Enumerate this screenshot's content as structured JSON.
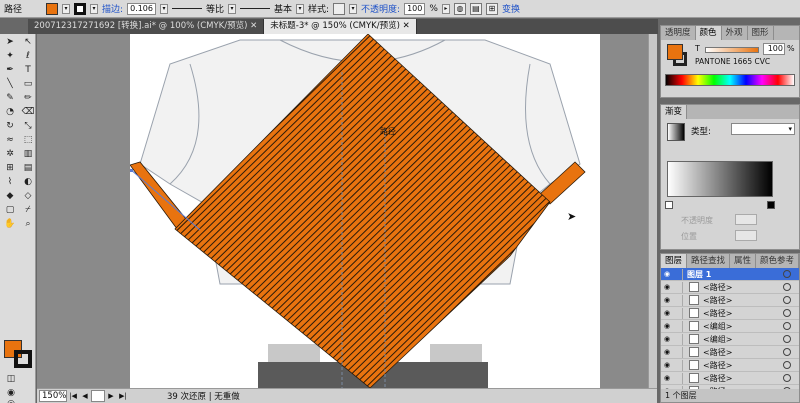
{
  "control_bar": {
    "object_label": "路径",
    "stroke_label": "描边:",
    "stroke_weight": "0.106",
    "profile_label": "等比",
    "brush_label": "基本",
    "style_label": "样式:",
    "opacity_label": "不透明度:",
    "opacity_value": "100",
    "percent": "%",
    "transform_label": "变换",
    "colors": {
      "fill": "#e8730f",
      "stroke": "#111111"
    }
  },
  "tabs": [
    {
      "label": "200712317271692 [转换].ai* @ 100% (CMYK/预览)",
      "active": false
    },
    {
      "label": "未标题-3* @ 150% (CMYK/预览)",
      "active": true
    }
  ],
  "toolbar": {
    "tools": [
      "selection-tool",
      "direct-selection-tool",
      "magic-wand-tool",
      "lasso-tool",
      "pen-tool",
      "type-tool",
      "line-tool",
      "rectangle-tool",
      "paintbrush-tool",
      "pencil-tool",
      "blob-brush-tool",
      "eraser-tool",
      "rotate-tool",
      "scale-tool",
      "warp-tool",
      "free-transform-tool",
      "symbol-sprayer-tool",
      "graph-tool",
      "mesh-tool",
      "gradient-tool",
      "eyedropper-tool",
      "blend-tool",
      "live-paint-tool",
      "live-paint-select-tool",
      "artboard-tool",
      "slice-tool",
      "hand-tool",
      "zoom-tool"
    ],
    "fill_color": "#e8730f",
    "stroke_color": "#111111"
  },
  "canvas": {
    "path_label": "路径",
    "colors": {
      "stripe_fill": "#e8730f",
      "stripe_line": "#2a1a0a",
      "shirt_outline": "#9aa2ad",
      "shirt_fill": "#f2f2f2",
      "pants": "#5a5a5a"
    }
  },
  "status_bar": {
    "zoom": "150%",
    "message": "39 次还原 | 无重做"
  },
  "color_panel": {
    "tabs": [
      {
        "label": "透明度",
        "active": false
      },
      {
        "label": "颜色",
        "active": true
      },
      {
        "label": "外观",
        "active": false
      },
      {
        "label": "图形",
        "active": false
      }
    ],
    "tint_label": "T",
    "tint_value": "100",
    "percent": "%",
    "swatch_name": "PANTONE 1665 CVC"
  },
  "gradient_panel": {
    "tabs": [
      {
        "label": "渐变",
        "active": true
      }
    ],
    "type_label": "类型:",
    "opacity_label": "不透明度",
    "location_label": "位置"
  },
  "layers_panel": {
    "tabs": [
      {
        "label": "图层",
        "active": true
      },
      {
        "label": "路径查找",
        "active": false
      },
      {
        "label": "属性",
        "active": false
      },
      {
        "label": "颜色参考",
        "active": false
      }
    ],
    "layer_name": "图层 1",
    "items": [
      "<路径>",
      "<路径>",
      "<路径>",
      "<编组>",
      "<编组>",
      "<路径>",
      "<路径>",
      "<路径>",
      "<路径>"
    ],
    "footer": "1 个图层"
  }
}
